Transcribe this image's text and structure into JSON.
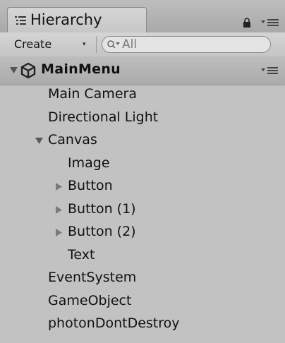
{
  "window": {
    "tab_label": "Hierarchy",
    "tab_icon": "hierarchy-list-icon",
    "lock_icon": "lock-icon",
    "menu_icon": "tab-menu-icon"
  },
  "toolbar": {
    "create_label": "Create",
    "create_arrow": "▾",
    "search_placeholder": "All",
    "search_icon": "search-icon"
  },
  "scene": {
    "name": "MainMenu",
    "expanded": true,
    "icon": "unity-logo-icon",
    "menu_icon": "scene-menu-icon"
  },
  "tree": [
    {
      "label": "Main Camera",
      "depth": 0,
      "foldout": "none"
    },
    {
      "label": "Directional Light",
      "depth": 0,
      "foldout": "none"
    },
    {
      "label": "Canvas",
      "depth": 0,
      "foldout": "expanded"
    },
    {
      "label": "Image",
      "depth": 1,
      "foldout": "none"
    },
    {
      "label": "Button",
      "depth": 1,
      "foldout": "collapsed"
    },
    {
      "label": "Button (1)",
      "depth": 1,
      "foldout": "collapsed"
    },
    {
      "label": "Button (2)",
      "depth": 1,
      "foldout": "collapsed"
    },
    {
      "label": "Text",
      "depth": 1,
      "foldout": "none"
    },
    {
      "label": "EventSystem",
      "depth": 0,
      "foldout": "none"
    },
    {
      "label": "GameObject",
      "depth": 0,
      "foldout": "none"
    },
    {
      "label": "photonDontDestroy",
      "depth": 0,
      "foldout": "none"
    }
  ],
  "colors": {
    "panel_bg": "#c2c2c2",
    "text": "#111111",
    "foldout": "#5a5a5a",
    "collapsed_foldout": "#7a7a7a"
  }
}
